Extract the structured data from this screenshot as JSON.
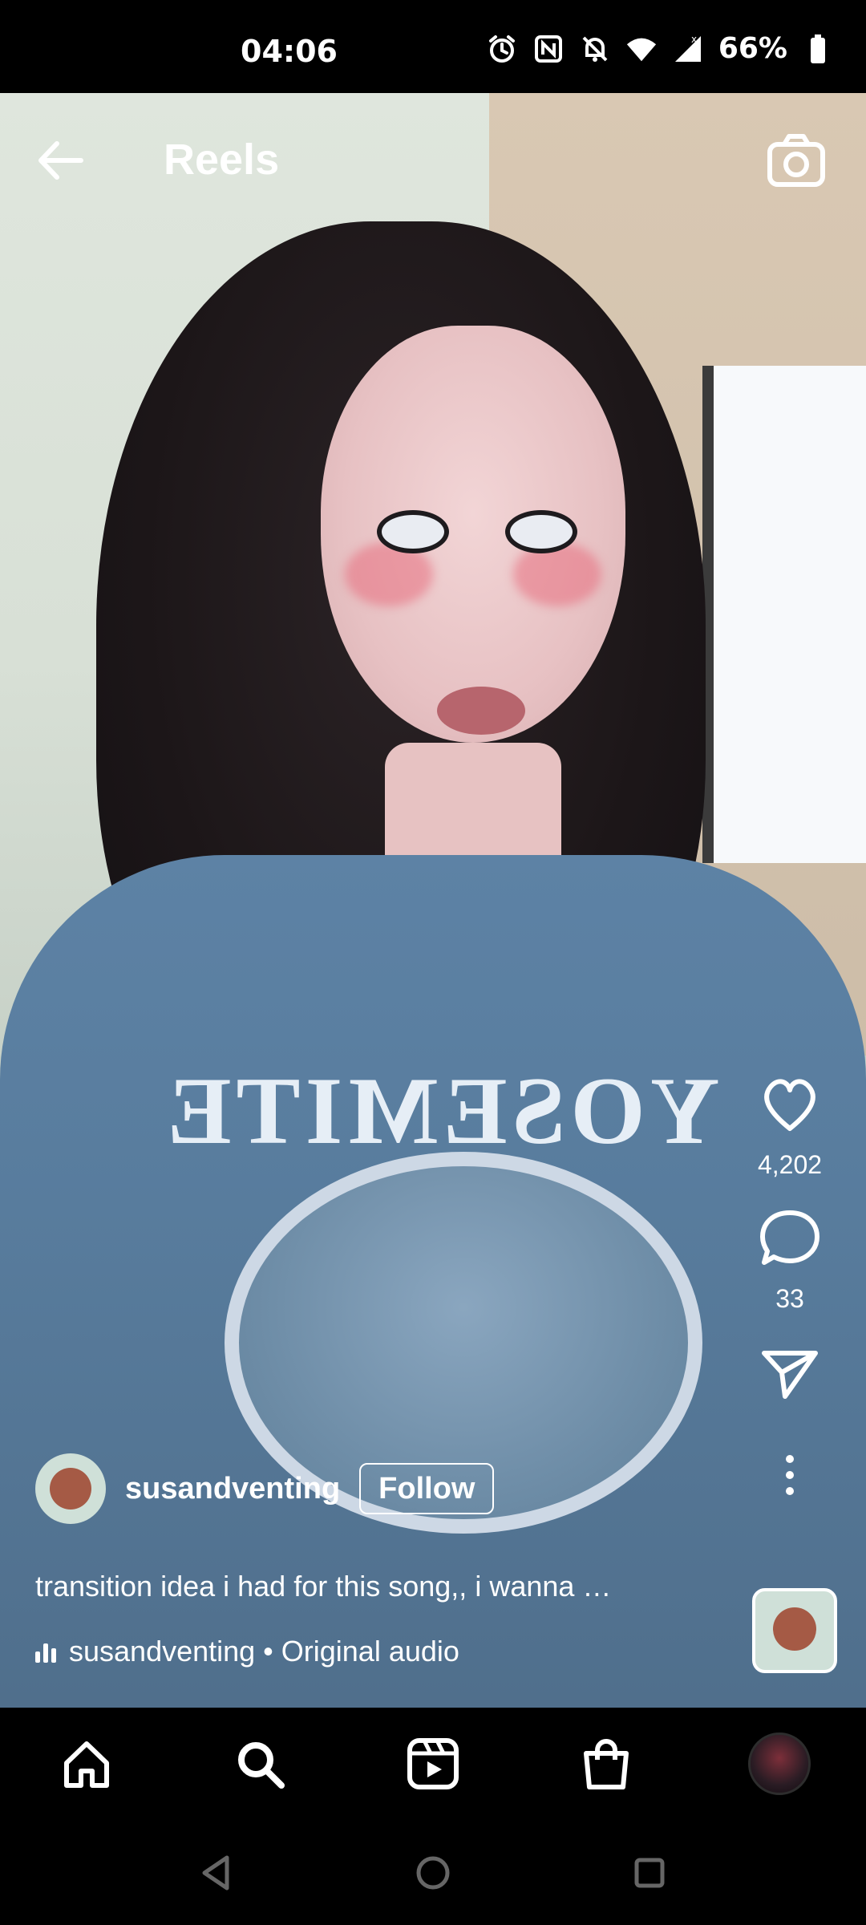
{
  "status_bar": {
    "time": "04:06",
    "battery": "66%",
    "icons": [
      "alarm-icon",
      "nfc-icon",
      "bell-off-icon",
      "wifi-icon",
      "signal-icon",
      "battery-icon"
    ]
  },
  "header": {
    "title": "Reels",
    "back_icon": "arrow-left-icon",
    "camera_icon": "camera-icon"
  },
  "actions": {
    "like_count": "4,202",
    "comment_count": "33"
  },
  "post": {
    "username": "susandventing",
    "follow_label": "Follow",
    "caption": "transition idea i had for this song,, i wanna …",
    "audio_text": "susandventing • Original audio"
  },
  "video_print": {
    "text": "YOSEMITE"
  },
  "bottom_nav": {
    "items": [
      "home-icon",
      "search-icon",
      "reels-icon",
      "shop-icon",
      "profile-avatar"
    ]
  },
  "system_nav": {
    "items": [
      "back-triangle-icon",
      "home-circle-icon",
      "recents-square-icon"
    ]
  },
  "colors": {
    "background": "#000000",
    "text": "#ffffff",
    "sweater": "#5a7ea0"
  }
}
